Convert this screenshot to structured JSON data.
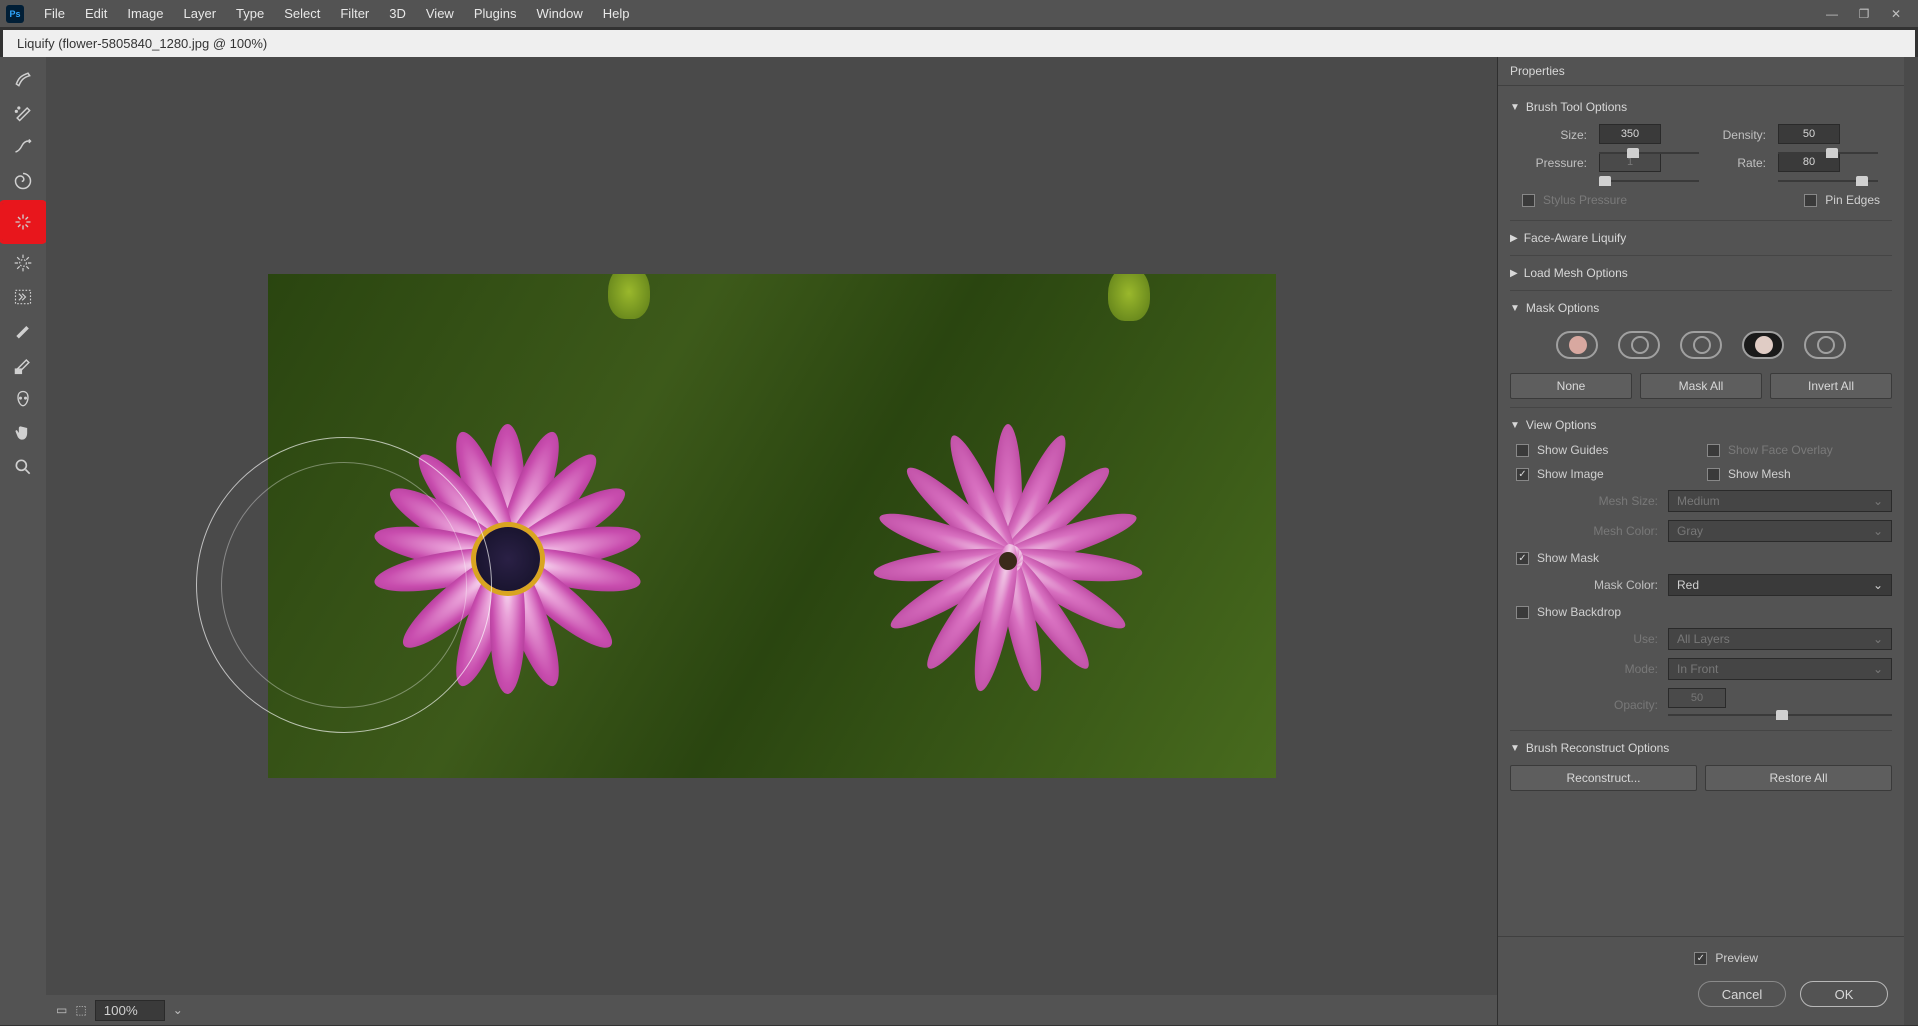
{
  "menubar": {
    "items": [
      "File",
      "Edit",
      "Image",
      "Layer",
      "Type",
      "Select",
      "Filter",
      "3D",
      "View",
      "Plugins",
      "Window",
      "Help"
    ]
  },
  "document": {
    "title": "Liquify (flower-5805840_1280.jpg @ 100%)"
  },
  "zoom": {
    "value": "100%"
  },
  "panel": {
    "title": "Properties",
    "sections": {
      "brush_tool": {
        "title": "Brush Tool Options",
        "size_label": "Size:",
        "size_value": "350",
        "density_label": "Density:",
        "density_value": "50",
        "pressure_label": "Pressure:",
        "pressure_value": "1",
        "rate_label": "Rate:",
        "rate_value": "80",
        "stylus_label": "Stylus Pressure",
        "pin_edges_label": "Pin Edges"
      },
      "face_aware": {
        "title": "Face-Aware Liquify"
      },
      "load_mesh": {
        "title": "Load Mesh Options"
      },
      "mask_options": {
        "title": "Mask Options",
        "none": "None",
        "mask_all": "Mask All",
        "invert_all": "Invert All"
      },
      "view_options": {
        "title": "View Options",
        "show_guides": "Show Guides",
        "show_face_overlay": "Show Face Overlay",
        "show_image": "Show Image",
        "show_mesh": "Show Mesh",
        "mesh_size_label": "Mesh Size:",
        "mesh_size_value": "Medium",
        "mesh_color_label": "Mesh Color:",
        "mesh_color_value": "Gray",
        "show_mask": "Show Mask",
        "mask_color_label": "Mask Color:",
        "mask_color_value": "Red",
        "show_backdrop": "Show Backdrop",
        "use_label": "Use:",
        "use_value": "All Layers",
        "mode_label": "Mode:",
        "mode_value": "In Front",
        "opacity_label": "Opacity:",
        "opacity_value": "50"
      },
      "brush_reconstruct": {
        "title": "Brush Reconstruct Options",
        "reconstruct": "Reconstruct...",
        "restore_all": "Restore All"
      }
    },
    "footer": {
      "preview": "Preview",
      "cancel": "Cancel",
      "ok": "OK"
    }
  }
}
